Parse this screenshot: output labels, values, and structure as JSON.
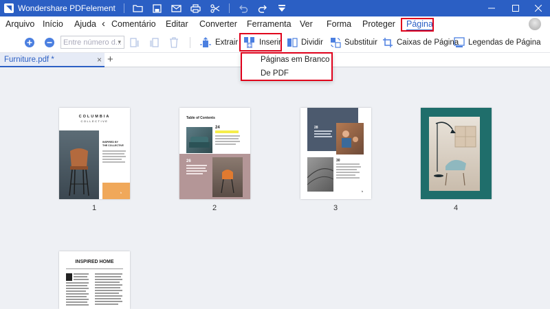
{
  "window": {
    "title": "Wondershare PDFelement",
    "colors": {
      "titlebar": "#2b5fc4",
      "accent": "#2b5fc4",
      "highlight": "#e0001b",
      "workspace": "#eef0f4"
    }
  },
  "menu": {
    "items": [
      "Arquivo",
      "Início",
      "Ajuda",
      "Comentário",
      "Editar",
      "Converter",
      "Ferramenta",
      "Ver",
      "Forma",
      "Proteger",
      "Página"
    ],
    "back_icon": "‹",
    "active": "Página"
  },
  "toolbar": {
    "page_input_placeholder": "Entre número d...",
    "extract_label": "Extrair",
    "insert_label": "Inserir",
    "split_label": "Dividir",
    "replace_label": "Substituir",
    "page_boxes_label": "Caixas de Página",
    "page_labels_label": "Legendas de Página"
  },
  "tabs": {
    "file_name": "Furniture.pdf *",
    "close": "×",
    "add": "+"
  },
  "insert_menu": {
    "items": [
      "Páginas em Branco",
      "De PDF"
    ]
  },
  "pages": [
    {
      "number": "1",
      "brand": "COLUMBIA",
      "brand_sub": "COLLECTIVE",
      "text_lines": [
        "INSPIRED BY",
        "THE COLLECTIVE"
      ],
      "corner": "h"
    },
    {
      "number": "2",
      "heading": "Table of Contents",
      "items": [
        "24",
        "26"
      ]
    },
    {
      "number": "3",
      "items": [
        "28",
        "30"
      ],
      "corner": "h"
    },
    {
      "number": "4"
    },
    {
      "number": "5",
      "heading": "INSPIRED HOME"
    }
  ]
}
